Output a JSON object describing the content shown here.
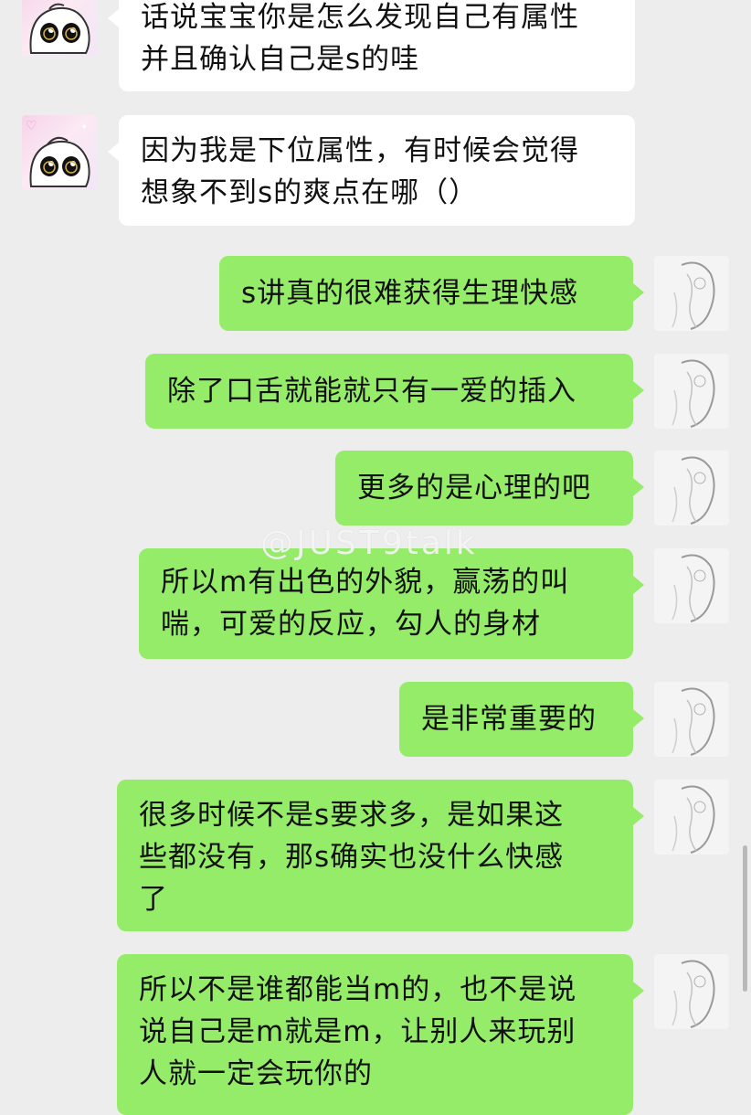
{
  "messages": [
    {
      "side": "left",
      "text": "话说宝宝你是怎么发现自己有属性\n并且确认自己是s的哇"
    },
    {
      "side": "left",
      "text": "因为我是下位属性，有时候会觉得\n想象不到s的爽点在哪（）"
    },
    {
      "side": "right",
      "text": "s讲真的很难获得生理快感"
    },
    {
      "side": "right",
      "text": "除了口舌就能就只有一爱的插入"
    },
    {
      "side": "right",
      "text": "更多的是心理的吧"
    },
    {
      "side": "right",
      "text": "所以m有出色的外貌，赢荡的叫\n喘，可爱的反应，勾人的身材"
    },
    {
      "side": "right",
      "text": "是非常重要的"
    },
    {
      "side": "right",
      "text": "很多时候不是s要求多，是如果这\n些都没有，那s确实也没什么快感\n了"
    },
    {
      "side": "right",
      "text": "所以不是谁都能当m的，也不是说\n说自己是m就是m，让别人来玩别\n人就一定会玩你的"
    }
  ],
  "watermark": "@JUST9talk",
  "colors": {
    "self_bubble": "#95ec69",
    "other_bubble": "#ffffff",
    "background": "#ededed"
  },
  "avatars": {
    "other": "cartoon-cat-avatar",
    "self": "sketch-portrait-avatar"
  }
}
